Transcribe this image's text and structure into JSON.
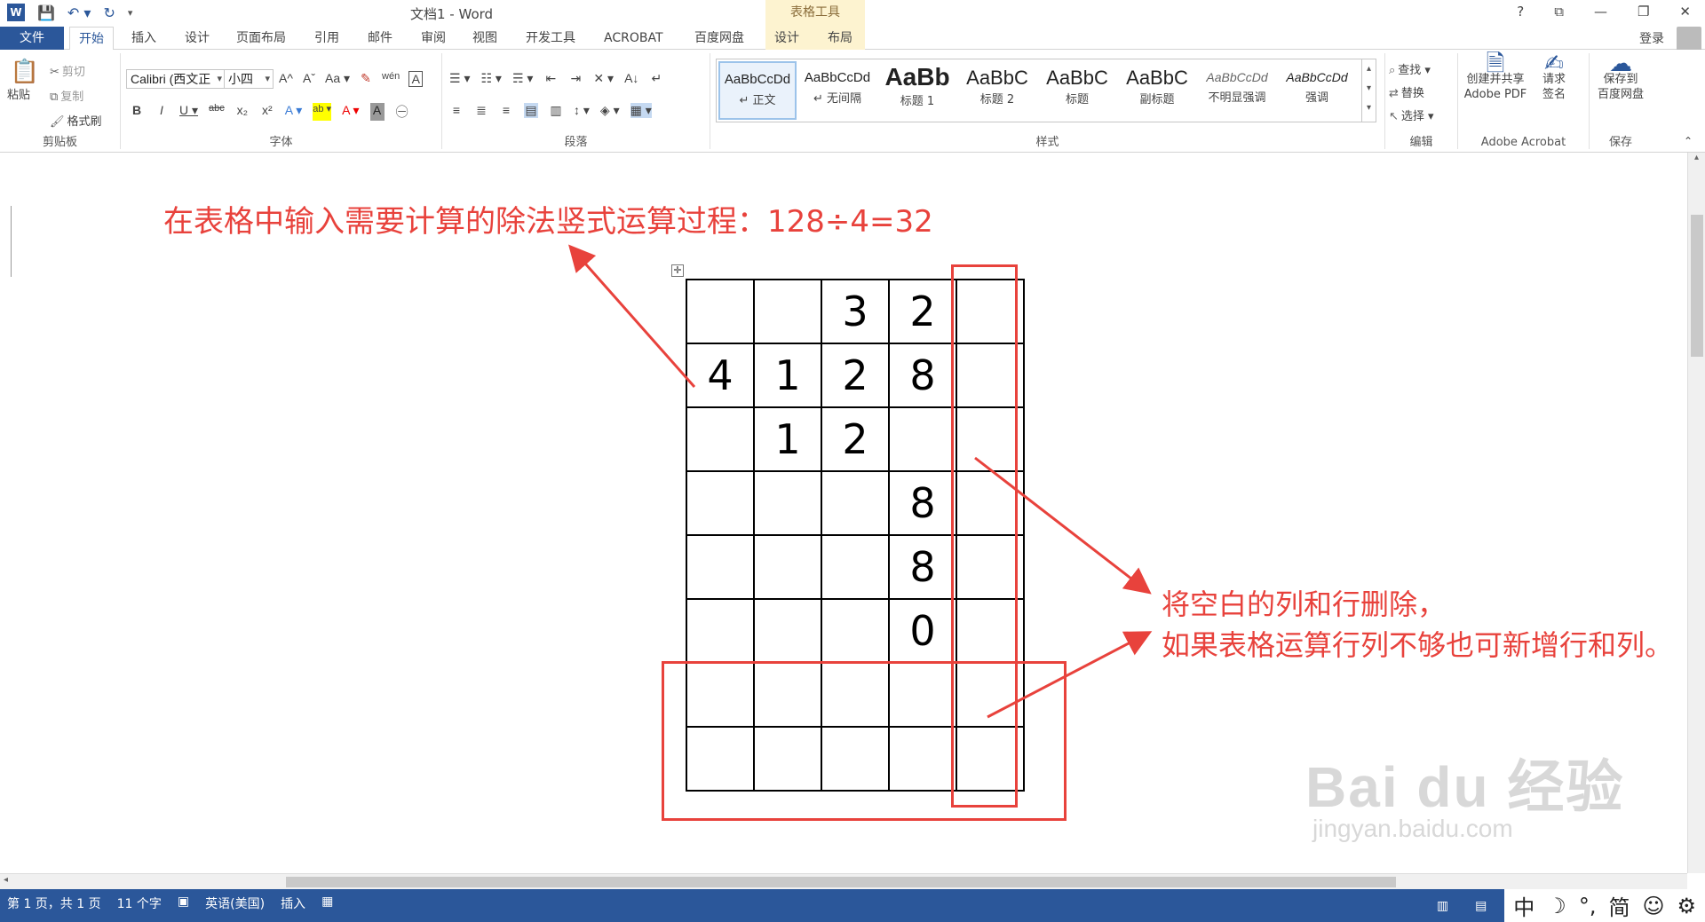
{
  "window": {
    "title": "文档1 - Word",
    "context_tools": "表格工具",
    "controls": [
      "?",
      "⧉",
      "—",
      "❐",
      "✕"
    ]
  },
  "tabs": {
    "file": "文件",
    "home": "开始",
    "insert": "插入",
    "design": "设计",
    "layout": "页面布局",
    "references": "引用",
    "mailings": "邮件",
    "review": "审阅",
    "view": "视图",
    "developer": "开发工具",
    "acrobat": "ACROBAT",
    "baidu": "百度网盘",
    "table_design": "设计",
    "table_layout": "布局",
    "login": "登录"
  },
  "clipboard": {
    "paste": "粘贴",
    "cut": "剪切",
    "copy": "复制",
    "format_painter": "格式刷",
    "label": "剪贴板"
  },
  "font": {
    "name": "Calibri (西文正",
    "size": "小四",
    "label": "字体",
    "row1": [
      "A^",
      "Aˇ",
      "Aa ▾",
      "✎",
      "wén",
      "A"
    ],
    "row2": [
      "B",
      "I",
      "U ▾",
      "abc",
      "x₂",
      "x²",
      "A ▾",
      "ab ▾",
      "A ▾",
      "A",
      "㊀"
    ]
  },
  "paragraph": {
    "label": "段落",
    "row1": [
      "☰ ▾",
      "☷ ▾",
      "☴ ▾",
      "⇤",
      "⇥",
      "✕ ▾",
      "A↓",
      "↵"
    ],
    "row2": [
      "≡",
      "≣",
      "≡",
      "▤",
      "▥",
      "↕ ▾",
      "◈ ▾",
      "▦ ▾"
    ]
  },
  "styles": {
    "label": "样式",
    "items": [
      {
        "sample": "AaBbCcDd",
        "name": "↵ 正文"
      },
      {
        "sample": "AaBbCcDd",
        "name": "↵ 无间隔"
      },
      {
        "sample": "AaBb",
        "name": "标题 1"
      },
      {
        "sample": "AaBbC",
        "name": "标题 2"
      },
      {
        "sample": "AaBbC",
        "name": "标题"
      },
      {
        "sample": "AaBbC",
        "name": "副标题"
      },
      {
        "sample": "AaBbCcDd",
        "name": "不明显强调"
      },
      {
        "sample": "AaBbCcDd",
        "name": "强调"
      }
    ]
  },
  "editing": {
    "find": "查找 ▾",
    "replace": "替换",
    "select": "选择 ▾",
    "label": "编辑"
  },
  "acrobat_group": {
    "create_share_line1": "创建并共享",
    "create_share_line2": "Adobe PDF",
    "request_sign_line1": "请求",
    "request_sign_line2": "签名",
    "label": "Adobe Acrobat"
  },
  "save_group": {
    "save_line1": "保存到",
    "save_line2": "百度网盘",
    "label": "保存"
  },
  "document": {
    "annotation_top": "在表格中输入需要计算的除法竖式运算过程：128÷4=32",
    "annotation_right_line1": "将空白的列和行删除，",
    "annotation_right_line2": "如果表格运算行列不够也可新增行和列。",
    "table": [
      [
        "",
        "",
        "3",
        "2",
        ""
      ],
      [
        "4",
        "1",
        "2",
        "8",
        ""
      ],
      [
        "",
        "1",
        "2",
        "",
        ""
      ],
      [
        "",
        "",
        "",
        "8",
        ""
      ],
      [
        "",
        "",
        "",
        "8",
        ""
      ],
      [
        "",
        "",
        "",
        "0",
        ""
      ],
      [
        "",
        "",
        "",
        "",
        ""
      ],
      [
        "",
        "",
        "",
        "",
        ""
      ]
    ],
    "annotation_color": "#e8423c"
  },
  "watermark": {
    "brand": "Bai du 经验",
    "url": "jingyan.baidu.com"
  },
  "status": {
    "page": "第 1 页，共 1 页",
    "words": "11 个字",
    "language": "英语(美国)",
    "mode": "插入"
  },
  "ime": {
    "lang": "中",
    "moon": "☽",
    "punct": "°,",
    "simp": "简",
    "emoji": "☺",
    "settings": "⚙"
  },
  "colors": {
    "brand": "#2b579a",
    "context_tab": "#fdf3d0"
  }
}
